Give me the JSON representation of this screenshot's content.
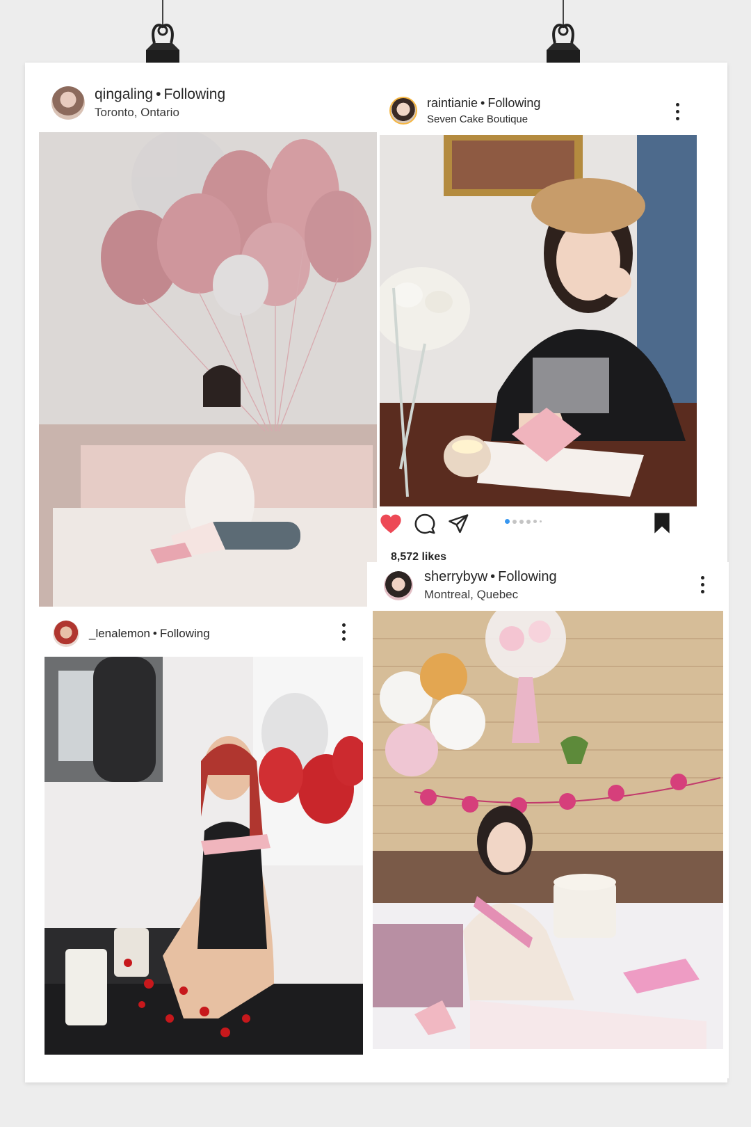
{
  "posts": [
    {
      "username": "qingaling",
      "follow_label": "Following",
      "location": "Toronto, Ontario",
      "photo_desc": "balloons-bedroom-photo"
    },
    {
      "username": "raintianie",
      "follow_label": "Following",
      "location": "Seven Cake Boutique",
      "likes": "8,572 likes",
      "carousel_total": 6,
      "carousel_active": 1
    },
    {
      "username": "_lenalemon",
      "follow_label": "Following",
      "location": ""
    },
    {
      "username": "sherrybyw",
      "follow_label": "Following",
      "location": "Montreal, Quebec"
    }
  ],
  "colors": {
    "like_red": "#ed4956",
    "carousel_active": "#3897f0",
    "carousel_inactive": "#c4c4c4",
    "text": "#262626"
  },
  "icons": {
    "like": "heart-icon",
    "comment": "comment-icon",
    "share": "paper-plane-icon",
    "save": "bookmark-icon",
    "more": "more-options-icon",
    "clip": "binder-clip-icon"
  }
}
